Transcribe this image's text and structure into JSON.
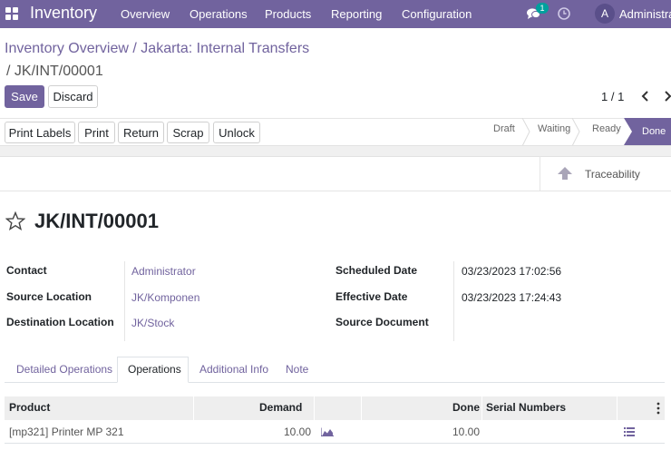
{
  "navbar": {
    "brand": "Inventory",
    "menu": [
      "Overview",
      "Operations",
      "Products",
      "Reporting",
      "Configuration"
    ],
    "chat_badge": "1",
    "avatar_letter": "A",
    "user": "Administrat"
  },
  "breadcrumb": {
    "parent": "Inventory Overview",
    "sep1": "/",
    "middle": "Jakarta: Internal Transfers",
    "current": "/ JK/INT/00001"
  },
  "buttons": {
    "save": "Save",
    "discard": "Discard"
  },
  "pager": "1 / 1",
  "actions": [
    "Print Labels",
    "Print",
    "Return",
    "Scrap",
    "Unlock"
  ],
  "stages": [
    "Draft",
    "Waiting",
    "Ready",
    "Done"
  ],
  "traceability": "Traceability",
  "record_title": "JK/INT/00001",
  "fields_left": {
    "contact_label": "Contact",
    "contact_value": "Administrator",
    "source_label": "Source Location",
    "source_value": "JK/Komponen",
    "dest_label": "Destination Location",
    "dest_value": "JK/Stock"
  },
  "fields_right": {
    "scheduled_label": "Scheduled Date",
    "scheduled_value": "03/23/2023 17:02:56",
    "effective_label": "Effective Date",
    "effective_value": "03/23/2023 17:24:43",
    "source_doc_label": "Source Document",
    "source_doc_value": ""
  },
  "tabs": [
    "Detailed Operations",
    "Operations",
    "Additional Info",
    "Note"
  ],
  "table": {
    "headers": {
      "product": "Product",
      "demand": "Demand",
      "done": "Done",
      "serial": "Serial Numbers"
    },
    "rows": [
      {
        "product": "[mp321] Printer MP 321",
        "demand": "10.00",
        "done": "10.00"
      }
    ]
  },
  "colors": {
    "brand": "#71639e",
    "badge": "#00a09d"
  }
}
